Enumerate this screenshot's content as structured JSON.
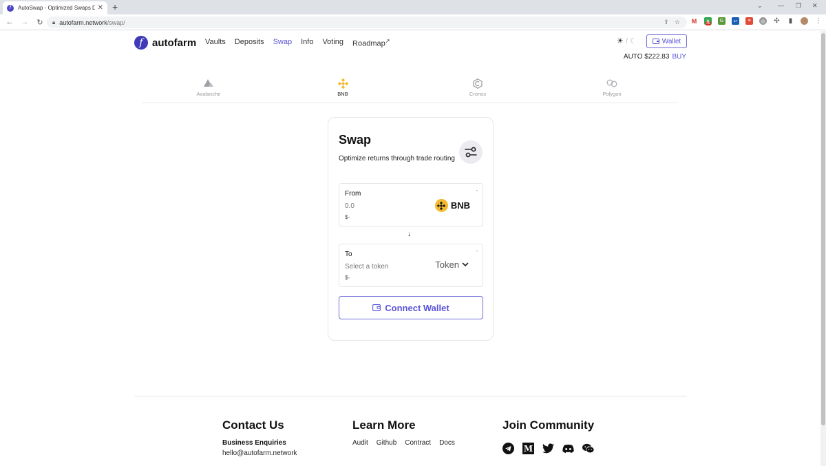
{
  "browser": {
    "tab_title": "AutoSwap - Optimized Swaps De",
    "url_host": "autofarm.network",
    "url_path": "/swap/",
    "ext_badge": "35"
  },
  "header": {
    "logo_text": "autofarm",
    "nav": [
      {
        "label": "Vaults",
        "active": false
      },
      {
        "label": "Deposits",
        "active": false
      },
      {
        "label": "Swap",
        "active": true
      },
      {
        "label": "Info",
        "active": false
      },
      {
        "label": "Voting",
        "active": false
      },
      {
        "label": "Roadmap",
        "active": false
      }
    ],
    "theme_separator": "/",
    "wallet_label": "Wallet",
    "auto_price": "AUTO $222.83",
    "buy_label": "BUY"
  },
  "chains": [
    {
      "label": "Avalanche",
      "icon": "avalanche-icon",
      "active": false
    },
    {
      "label": "BNB",
      "icon": "bnb-icon",
      "active": true
    },
    {
      "label": "Cronos",
      "icon": "cronos-icon",
      "active": false
    },
    {
      "label": "Polygon",
      "icon": "polygon-icon",
      "active": false
    }
  ],
  "swap": {
    "title": "Swap",
    "subtitle": "Optimize returns through trade routing",
    "from": {
      "label": "From",
      "balance": "-",
      "amount_placeholder": "0.0",
      "usd": "$-",
      "token": "BNB"
    },
    "to": {
      "label": "To",
      "balance": "-",
      "placeholder": "Select a token",
      "usd": "$-",
      "token": "Token"
    },
    "connect_label": "Connect Wallet"
  },
  "footer": {
    "contact": {
      "title": "Contact Us",
      "business_label": "Business Enquiries",
      "email": "hello@autofarm.network"
    },
    "learn": {
      "title": "Learn More",
      "links": [
        "Audit",
        "Github",
        "Contract",
        "Docs"
      ]
    },
    "community": {
      "title": "Join Community",
      "socials": [
        "telegram-icon",
        "medium-icon",
        "twitter-icon",
        "discord-icon",
        "wechat-icon"
      ]
    }
  },
  "colors": {
    "accent": "#5a55d6",
    "brand": "#3f3ab8",
    "bnb": "#f3ba2f"
  }
}
